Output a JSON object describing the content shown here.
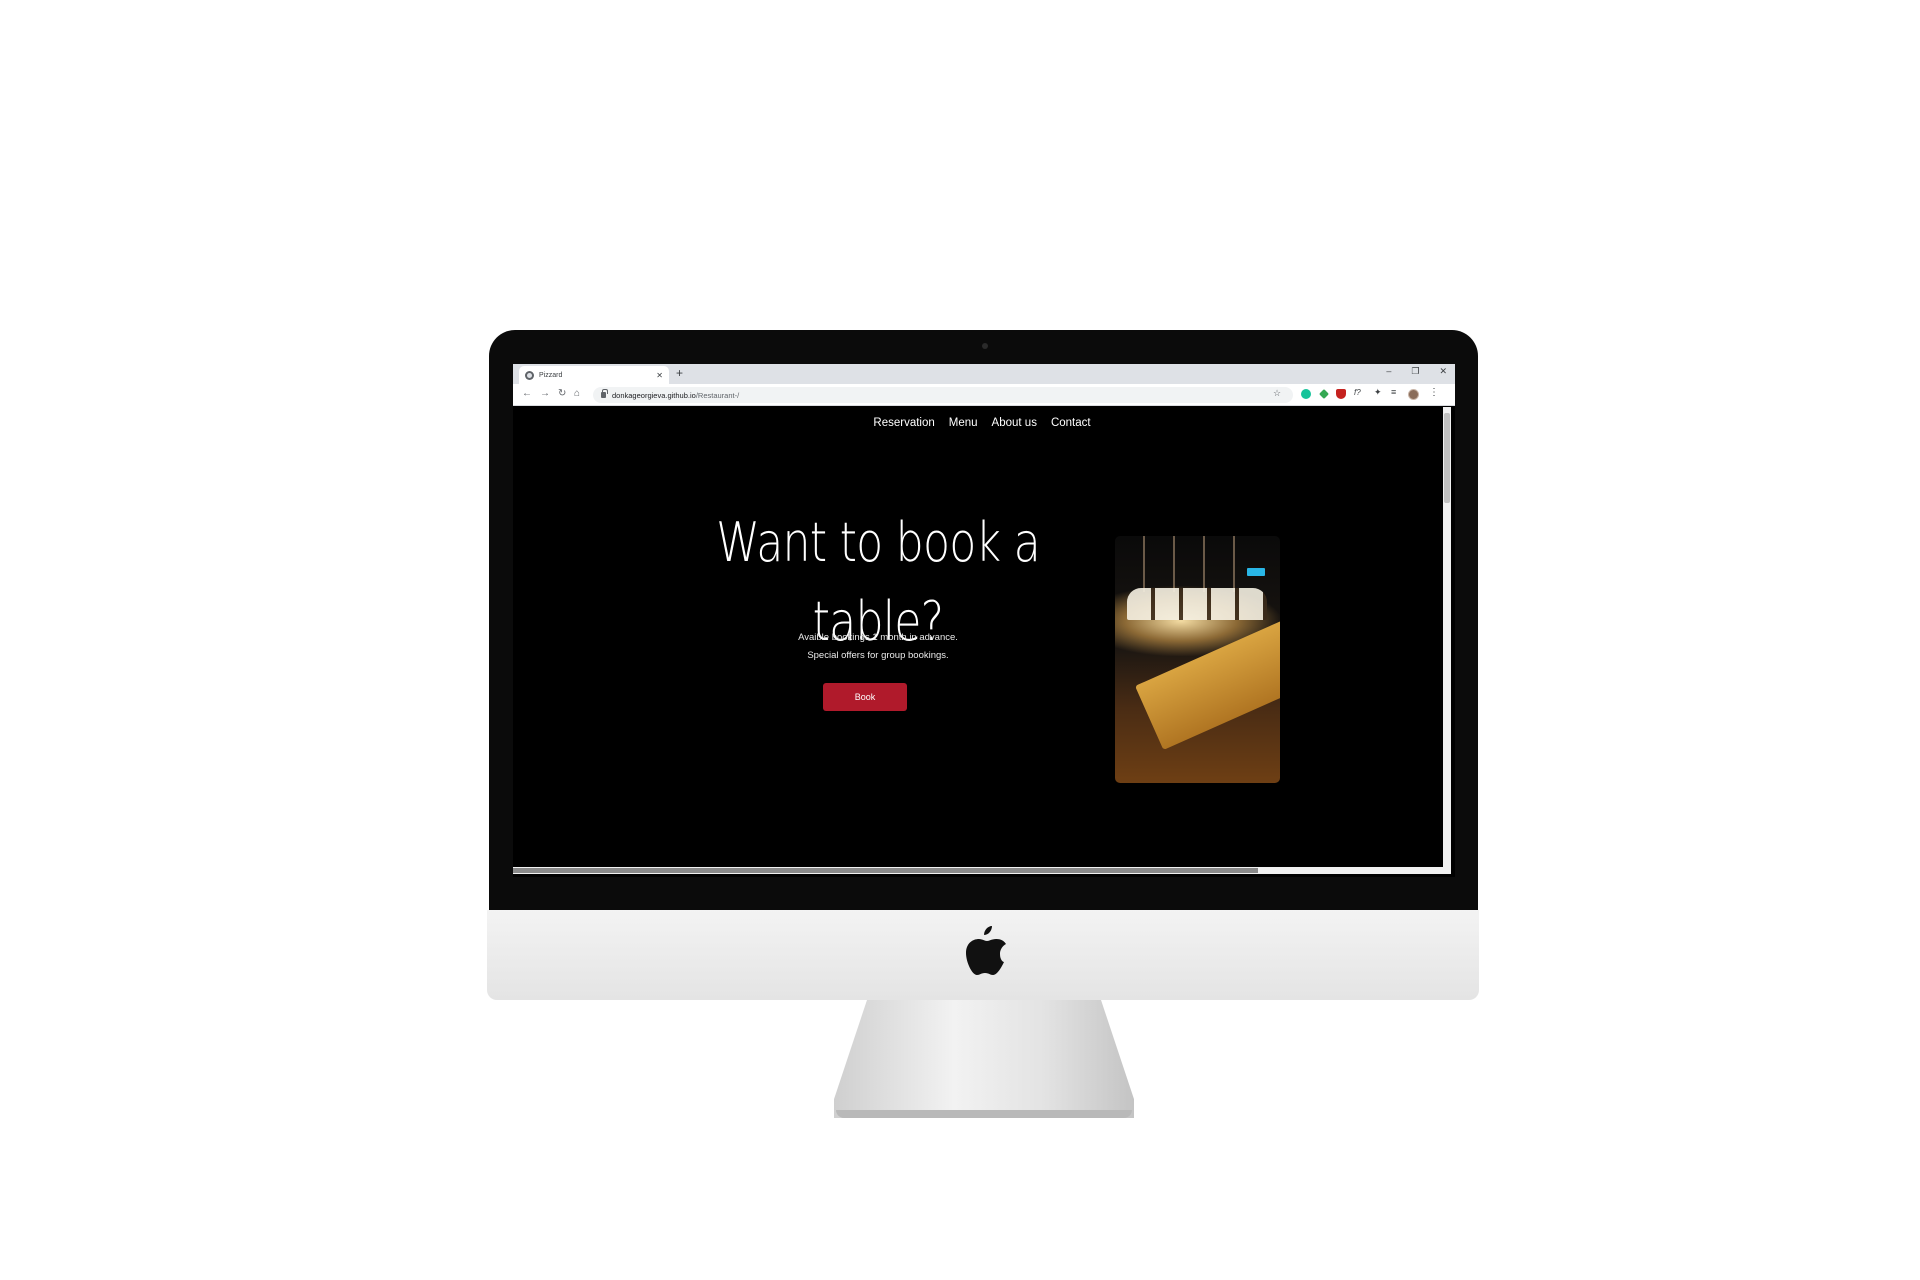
{
  "browser": {
    "tab_title": "Pizzard",
    "close_tab_label": "✕",
    "new_tab_label": "+",
    "window_controls": [
      "–",
      "❐",
      "✕"
    ],
    "url_host": "donkageorgieva.github.io",
    "url_path": "/Restaurant-/"
  },
  "site": {
    "nav": [
      "Reservation",
      "Menu",
      "About us",
      "Contact"
    ],
    "hero": {
      "title_line1": "Want to book a",
      "title_line2": "table?",
      "subtitle_line1": "Avaible bookings 1 month in advance.",
      "subtitle_line2": "Special offers for group bookings.",
      "button_label": "Book"
    }
  },
  "colors": {
    "page_background": "#000000",
    "accent_button": "#b01a2b",
    "browser_chrome": "#dee1e6"
  },
  "scroll": {
    "horizontal_position": 0.0,
    "vertical_position": 0.0
  }
}
